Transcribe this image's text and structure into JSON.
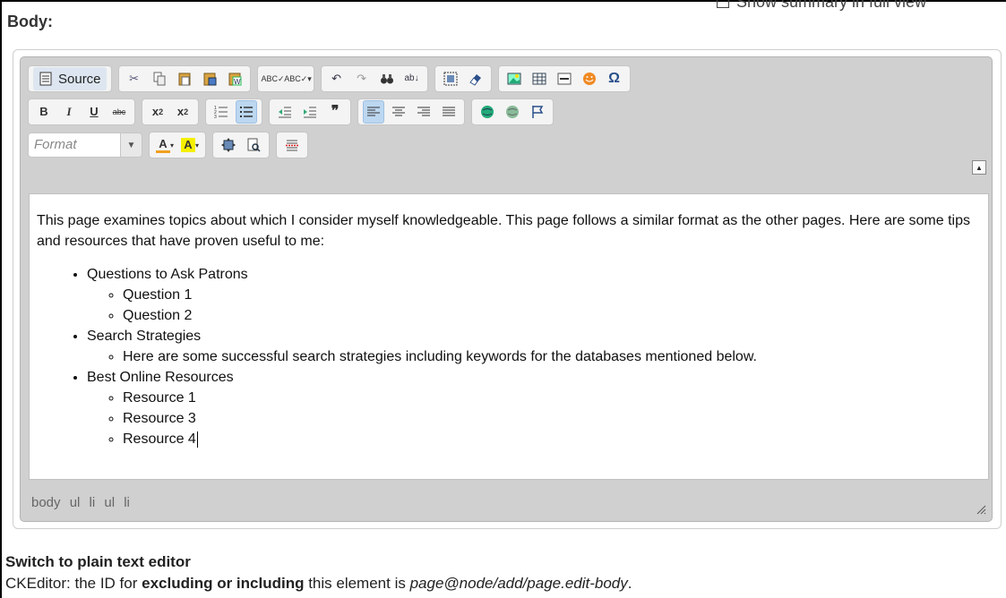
{
  "field": {
    "label": "Body:",
    "summary_link": "Show summary in full view"
  },
  "toolbar": {
    "source_label": "Source",
    "format_placeholder": "Format"
  },
  "content": {
    "intro": "This page examines topics about which I consider myself knowledgeable. This page follows a similar format as the other pages. Here are some tips and resources that have proven useful to me:",
    "list": [
      {
        "text": "Questions to Ask Patrons",
        "children": [
          "Question 1",
          "Question 2"
        ]
      },
      {
        "text": "Search Strategies",
        "children": [
          "Here are some successful search strategies including keywords for the databases mentioned below."
        ]
      },
      {
        "text": "Best Online Resources",
        "children": [
          "Resource 1",
          "Resource 3",
          "Resource 4"
        ]
      }
    ]
  },
  "elements_path": "body ul li ul li",
  "switch_editor": "Switch to plain text editor",
  "description": {
    "prefix": "CKEditor: the ID for ",
    "bold": "excluding or including",
    "middle": " this element is ",
    "italic": "page@node/add/page.edit-body",
    "suffix": "."
  },
  "colors": {
    "active_button": "#bcd7f0",
    "editor_chrome": "#d0d0d0"
  }
}
